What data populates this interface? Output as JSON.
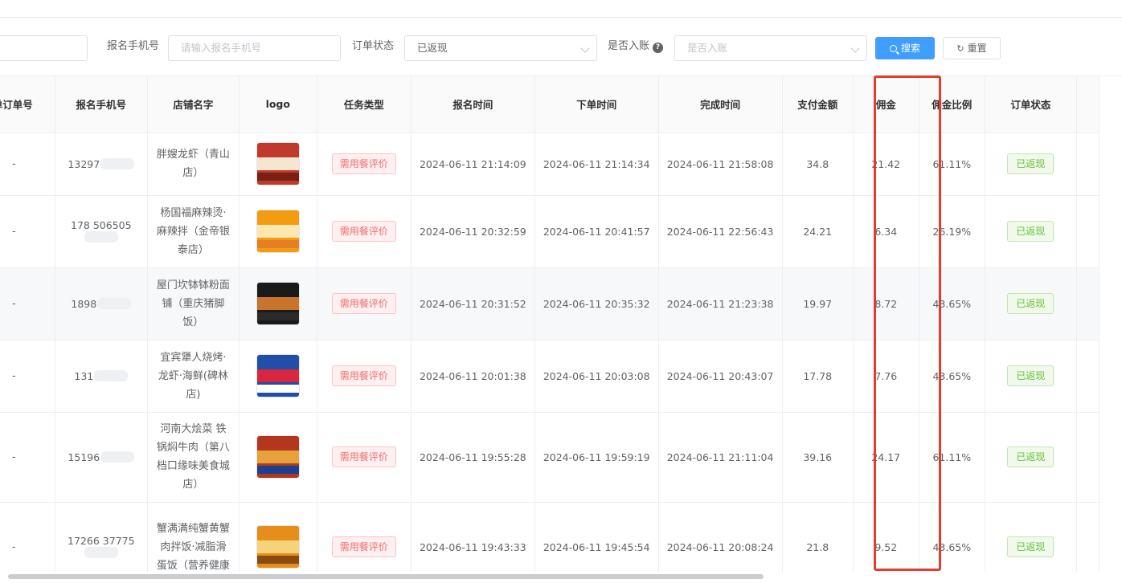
{
  "filters": {
    "phone_label": "报名手机号",
    "phone_placeholder": "请输入报名手机号",
    "order_status_label": "订单状态",
    "order_status_value": "已返现",
    "account_label": "是否入账",
    "account_placeholder": "是否入账",
    "search_button": "搜索",
    "reset_button": "重置"
  },
  "table": {
    "columns": [
      "单订单号",
      "报名手机号",
      "店铺名字",
      "logo",
      "任务类型",
      "报名时间",
      "下单时间",
      "完成时间",
      "支付金额",
      "佣金",
      "佣金比例",
      "订单状态"
    ],
    "rows": [
      {
        "order_no": "-",
        "phone": "13297",
        "store": "胖嫂龙虾（青山店）",
        "logo_colors": [
          "#c0392b",
          "#f5e6d0",
          "#7a1f14"
        ],
        "task_type": "需用餐评价",
        "signup_time": "2024-06-11 21:14:09",
        "order_time": "2024-06-11 21:14:34",
        "finish_time": "2024-06-11 21:58:08",
        "paid": "34.8",
        "commission": "21.42",
        "rate": "61.11%",
        "status": "已返现"
      },
      {
        "order_no": "-",
        "phone": "178 506505",
        "store": "杨国福麻辣烫·麻辣拌（金帝银泰店）",
        "logo_colors": [
          "#f39c12",
          "#fde7b0",
          "#e67e22"
        ],
        "task_type": "需用餐评价",
        "signup_time": "2024-06-11 20:32:59",
        "order_time": "2024-06-11 20:41:57",
        "finish_time": "2024-06-11 22:56:43",
        "paid": "24.21",
        "commission": "6.34",
        "rate": "26.19%",
        "status": "已返现"
      },
      {
        "order_no": "-",
        "phone": "1898",
        "store": "屋门坎钵钵粉面铺（重庆猪脚饭）",
        "logo_colors": [
          "#1a1a1a",
          "#c8742c",
          "#2b2b2b"
        ],
        "task_type": "需用餐评价",
        "signup_time": "2024-06-11 20:31:52",
        "order_time": "2024-06-11 20:35:32",
        "finish_time": "2024-06-11 21:23:38",
        "paid": "19.97",
        "commission": "8.72",
        "rate": "43.65%",
        "status": "已返现"
      },
      {
        "order_no": "-",
        "phone": "131",
        "store": "宜宾犟人烧烤·龙虾·海鲜(碑林店)",
        "logo_colors": [
          "#1f4fa8",
          "#d7263d",
          "#ffffff"
        ],
        "task_type": "需用餐评价",
        "signup_time": "2024-06-11 20:01:38",
        "order_time": "2024-06-11 20:03:08",
        "finish_time": "2024-06-11 20:43:07",
        "paid": "17.78",
        "commission": "7.76",
        "rate": "43.65%",
        "status": "已返现"
      },
      {
        "order_no": "-",
        "phone": "15196",
        "store": "河南大烩菜 铁锅焖牛肉（第八档口缘味美食城店）",
        "logo_colors": [
          "#b3361f",
          "#e8a23b",
          "#1d3f8f"
        ],
        "task_type": "需用餐评价",
        "signup_time": "2024-06-11 19:55:28",
        "order_time": "2024-06-11 19:59:19",
        "finish_time": "2024-06-11 21:11:04",
        "paid": "39.16",
        "commission": "24.17",
        "rate": "61.11%",
        "status": "已返现"
      },
      {
        "order_no": "-",
        "phone": "17266 37775",
        "store": "蟹满满纯蟹黄蟹肉拌饭·减脂滑蛋饭（营养健康",
        "logo_colors": [
          "#e58e1a",
          "#f6d27a",
          "#8a4b12"
        ],
        "task_type": "需用餐评价",
        "signup_time": "2024-06-11 19:43:33",
        "order_time": "2024-06-11 19:45:54",
        "finish_time": "2024-06-11 20:08:24",
        "paid": "21.8",
        "commission": "9.52",
        "rate": "43.65%",
        "status": "已返现"
      }
    ]
  },
  "colors": {
    "primary": "#409eff",
    "danger": "#f56c6c",
    "success": "#67c23a",
    "highlight": "#e53b2c"
  }
}
